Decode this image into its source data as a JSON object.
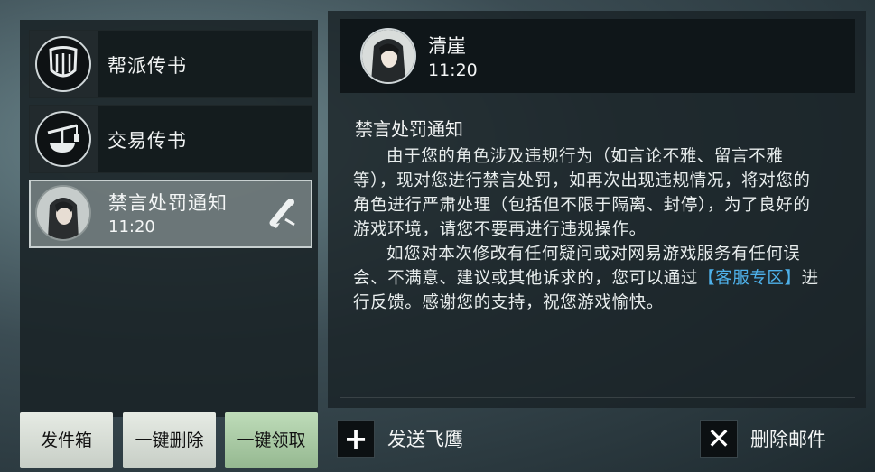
{
  "mail_list": [
    {
      "title": "帮派传书",
      "icon": "guild-shield-icon"
    },
    {
      "title": "交易传书",
      "icon": "trade-scale-icon"
    },
    {
      "title": "禁言处罚通知",
      "time": "11:20",
      "icon": "character-avatar",
      "selected": true,
      "action_icon": "scroll-icon"
    }
  ],
  "left_buttons": {
    "outbox": "发件箱",
    "delete_all": "一键删除",
    "claim_all": "一键领取"
  },
  "sender": {
    "name": "清崖",
    "time": "11:20"
  },
  "mail": {
    "title": "禁言处罚通知",
    "para1": "由于您的角色涉及违规行为（如言论不雅、留言不雅等），现对您进行禁言处罚，如再次出现违规情况，将对您的角色进行严肃处理（包括但不限于隔离、封停），为了良好的游戏环境，请您不要再进行违规操作。",
    "para2_before": "如您对本次修改有任何疑问或对网易游戏服务有任何误会、不满意、建议或其他诉求的，您可以通过",
    "link": "【客服专区】",
    "para2_after": "进行反馈。感谢您的支持，祝您游戏愉快。"
  },
  "actions": {
    "send": "发送飞鹰",
    "delete": "删除邮件"
  },
  "colors": {
    "link": "#4eb1ea",
    "claim_button": "#a9cba4"
  }
}
